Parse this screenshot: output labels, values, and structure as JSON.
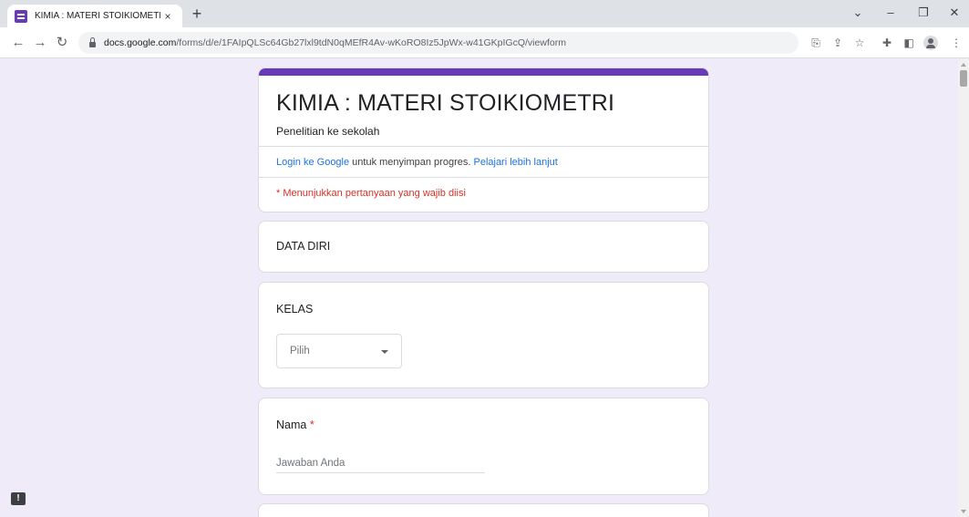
{
  "browser": {
    "tab_title": "KIMIA : MATERI STOIKIOMETRI",
    "tab_close": "×",
    "new_tab": "+",
    "url_host": "docs.google.com",
    "url_path": "/forms/d/e/1FAIpQLSc64Gb27lxl9tdN0qMEfR4Av-wKoRO8Iz5JpWx-w41GKpIGcQ/viewform",
    "icons": [
      "back-arrow-icon",
      "forward-arrow-icon",
      "reload-icon",
      "lock-icon",
      "translate-icon",
      "share-icon",
      "star-icon",
      "extensions-icon",
      "side-panel-icon",
      "profile-icon",
      "menu-icon"
    ]
  },
  "form": {
    "accent_color": "#673ab7",
    "background_color": "#f0ebf8",
    "title": "KIMIA : MATERI STOIKIOMETRI",
    "description": "Penelitian ke sekolah",
    "login": {
      "link_text": "Login ke Google",
      "middle_text": " untuk menyimpan progres. ",
      "learn_more": "Pelajari lebih lanjut"
    },
    "required_note": "* Menunjukkan pertanyaan yang wajib diisi",
    "section_title": "DATA DIRI",
    "questions": [
      {
        "title": "KELAS",
        "required": false,
        "type": "dropdown",
        "selected": "Pilih"
      },
      {
        "title": "Nama",
        "required": true,
        "asterisk": "*",
        "type": "short-text",
        "placeholder": "Jawaban Anda"
      }
    ]
  }
}
